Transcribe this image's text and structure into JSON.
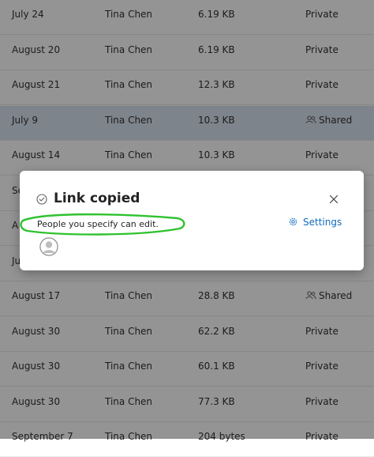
{
  "files": {
    "rows": [
      {
        "date": "July 24",
        "owner": "Tina Chen",
        "size": "6.19 KB",
        "sharing": "Private",
        "shared": false
      },
      {
        "date": "August 20",
        "owner": "Tina Chen",
        "size": "6.19 KB",
        "sharing": "Private",
        "shared": false
      },
      {
        "date": "August 21",
        "owner": "Tina Chen",
        "size": "12.3 KB",
        "sharing": "Private",
        "shared": false
      },
      {
        "date": "July 9",
        "owner": "Tina Chen",
        "size": "10.3 KB",
        "sharing": "Shared",
        "shared": true,
        "selected": true
      },
      {
        "date": "August 14",
        "owner": "Tina Chen",
        "size": "10.3 KB",
        "sharing": "Private",
        "shared": false
      },
      {
        "date": "Se",
        "owner": "",
        "size": "",
        "sharing": "",
        "shared": false
      },
      {
        "date": "A",
        "owner": "",
        "size": "",
        "sharing": "",
        "shared": false
      },
      {
        "date": "Ju",
        "owner": "",
        "size": "",
        "sharing": "",
        "shared": false
      },
      {
        "date": "August 17",
        "owner": "Tina Chen",
        "size": "28.8 KB",
        "sharing": "Shared",
        "shared": true
      },
      {
        "date": "August 30",
        "owner": "Tina Chen",
        "size": "62.2 KB",
        "sharing": "Private",
        "shared": false
      },
      {
        "date": "August 30",
        "owner": "Tina Chen",
        "size": "60.1 KB",
        "sharing": "Private",
        "shared": false
      },
      {
        "date": "August 30",
        "owner": "Tina Chen",
        "size": "77.3 KB",
        "sharing": "Private",
        "shared": false
      },
      {
        "date": "September 7",
        "owner": "Tina Chen",
        "size": "204 bytes",
        "sharing": "Private",
        "shared": false
      }
    ]
  },
  "dialog": {
    "title": "Link copied",
    "permission_text": "People you specify can edit.",
    "settings_label": "Settings",
    "check_icon": "check-circle-icon",
    "close_icon": "close-icon",
    "settings_icon": "gear-icon",
    "avatar_icon": "person-avatar-icon",
    "highlight_color": "#2fc22f"
  },
  "colors": {
    "accent": "#0f6cbd",
    "selected_row": "#d9e4f2",
    "text": "#323130"
  }
}
